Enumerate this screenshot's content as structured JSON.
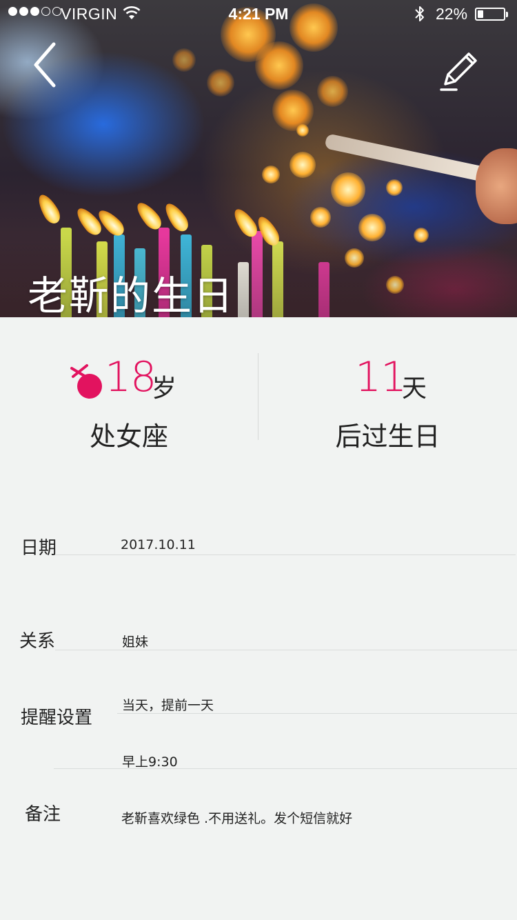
{
  "status_bar": {
    "carrier": "VIRGIN",
    "time": "4:21 PM",
    "battery_percent_text": "22%",
    "battery_level": 0.22,
    "signal_bars_filled": 3,
    "signal_bars_total": 5
  },
  "header": {
    "title": "老靳的生日",
    "back_icon": "chevron-left-icon",
    "edit_icon": "pencil-icon"
  },
  "stats": {
    "age": "18",
    "age_unit": "岁",
    "zodiac": "处女座",
    "zodiac_icon": "virgo-symbol-icon",
    "days": "11",
    "days_unit": "天",
    "days_label": "后过生日",
    "accent_color": "#e2135f"
  },
  "details": {
    "date_label": "日期",
    "date_value": "2017.10.11",
    "relation_label": "关系",
    "relation_value": "姐妹",
    "reminder_label": "提醒设置",
    "reminder_days": "当天，提前一天",
    "reminder_time": "早上9:30",
    "note_label": "备注",
    "note_value": "老靳喜欢绿色 .不用送礼。发个短信就好"
  }
}
